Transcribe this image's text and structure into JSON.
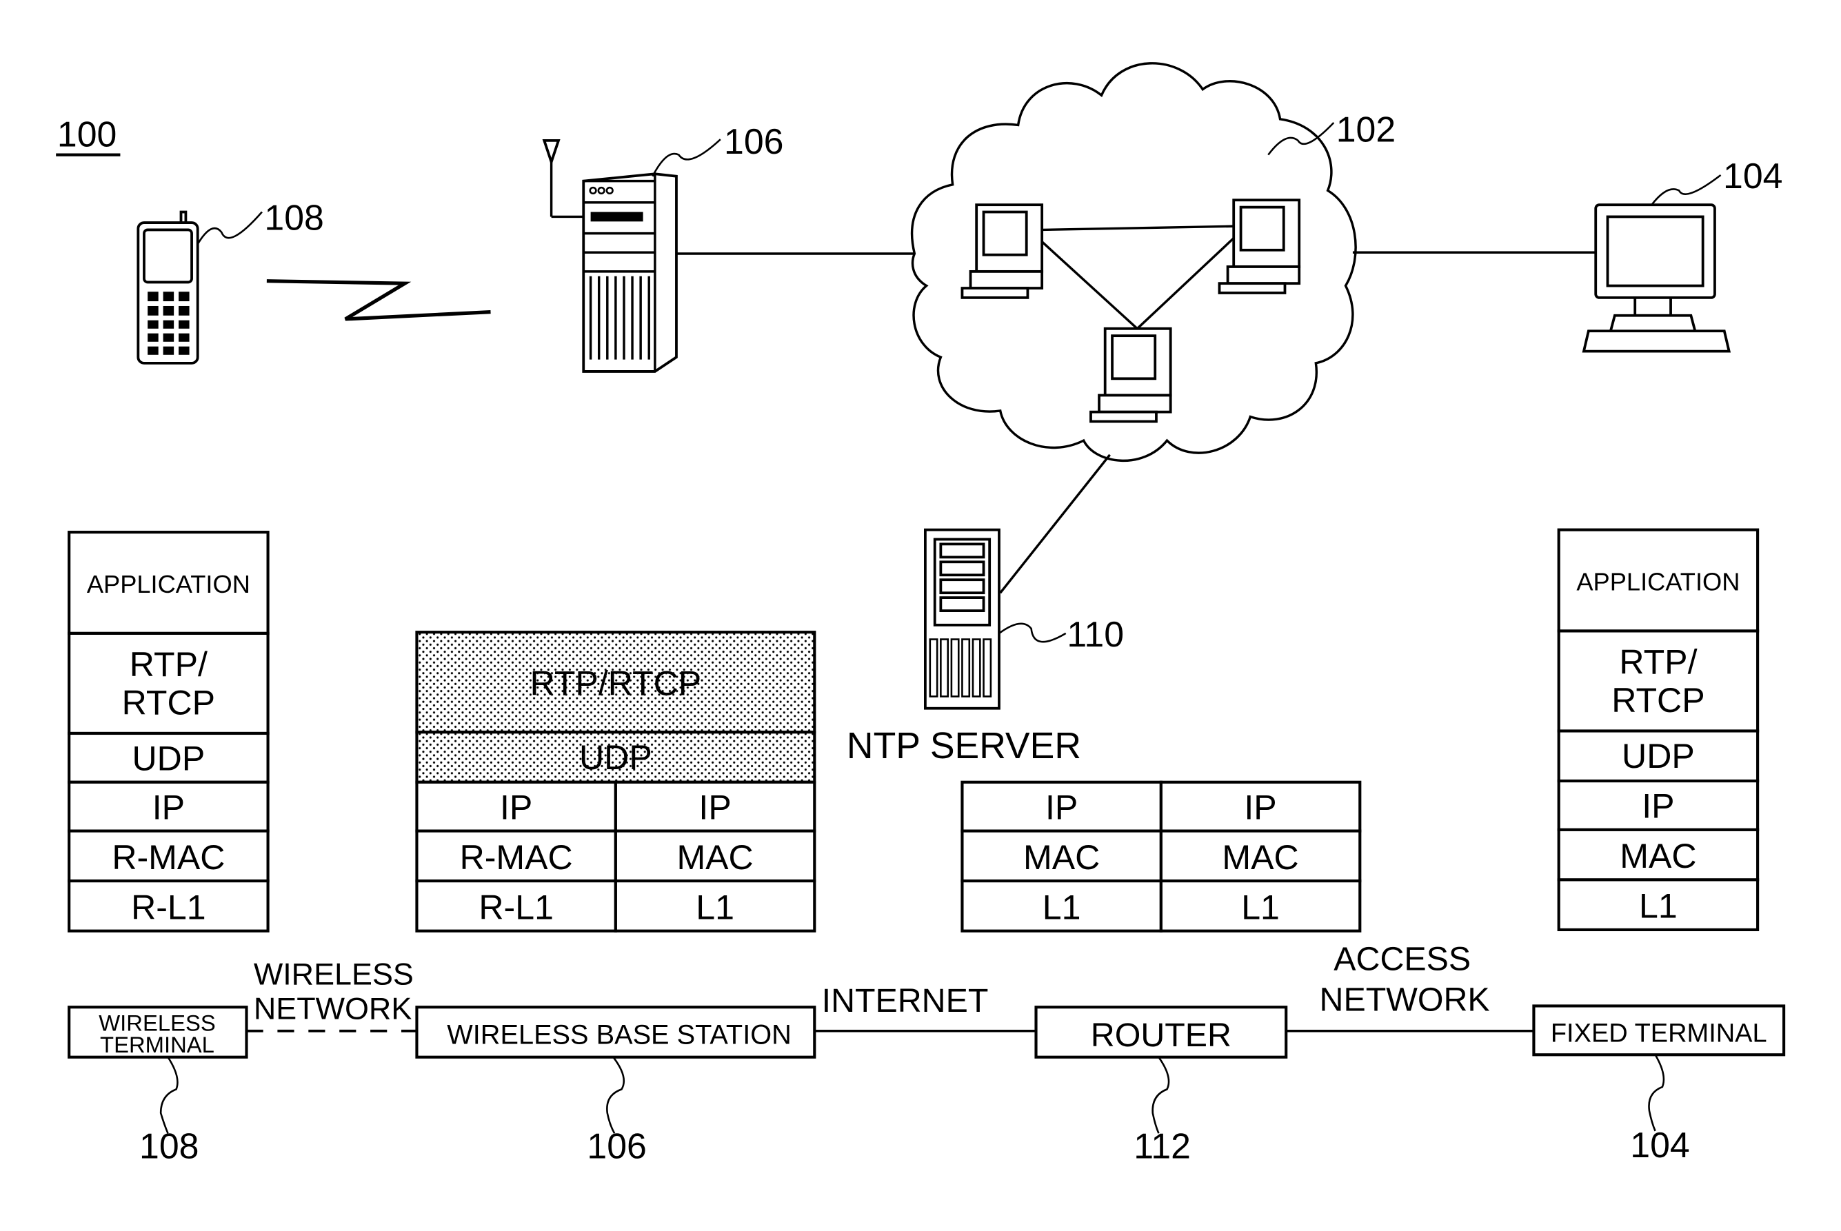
{
  "figure": {
    "label": "100"
  },
  "top": {
    "wireless_terminal_ref": "108",
    "base_station_ref": "106",
    "network_ref": "102",
    "fixed_terminal_ref": "104",
    "ntp_server_ref": "110",
    "ntp_server_label": "NTP SERVER"
  },
  "stacks": {
    "wireless_terminal": [
      "APPLICATION",
      "RTP/\nRTCP",
      "UDP",
      "IP",
      "R-MAC",
      "R-L1"
    ],
    "base_station": {
      "shared": [
        "RTP/RTCP",
        "UDP"
      ],
      "left": [
        "IP",
        "R-MAC",
        "R-L1"
      ],
      "right": [
        "IP",
        "MAC",
        "L1"
      ]
    },
    "router": {
      "left": [
        "IP",
        "MAC",
        "L1"
      ],
      "right": [
        "IP",
        "MAC",
        "L1"
      ]
    },
    "fixed_terminal": [
      "APPLICATION",
      "RTP/\nRTCP",
      "UDP",
      "IP",
      "MAC",
      "L1"
    ]
  },
  "bottom": {
    "nodes": [
      {
        "label": "WIRELESS\nTERMINAL",
        "ref": "108"
      },
      {
        "label": "WIRELESS BASE STATION",
        "ref": "106"
      },
      {
        "label": "ROUTER",
        "ref": "112"
      },
      {
        "label": "FIXED TERMINAL",
        "ref": "104"
      }
    ],
    "links": [
      {
        "label": "WIRELESS\nNETWORK",
        "style": "dashed"
      },
      {
        "label": "INTERNET",
        "style": "solid"
      },
      {
        "label": "ACCESS\nNETWORK",
        "style": "solid"
      }
    ]
  }
}
